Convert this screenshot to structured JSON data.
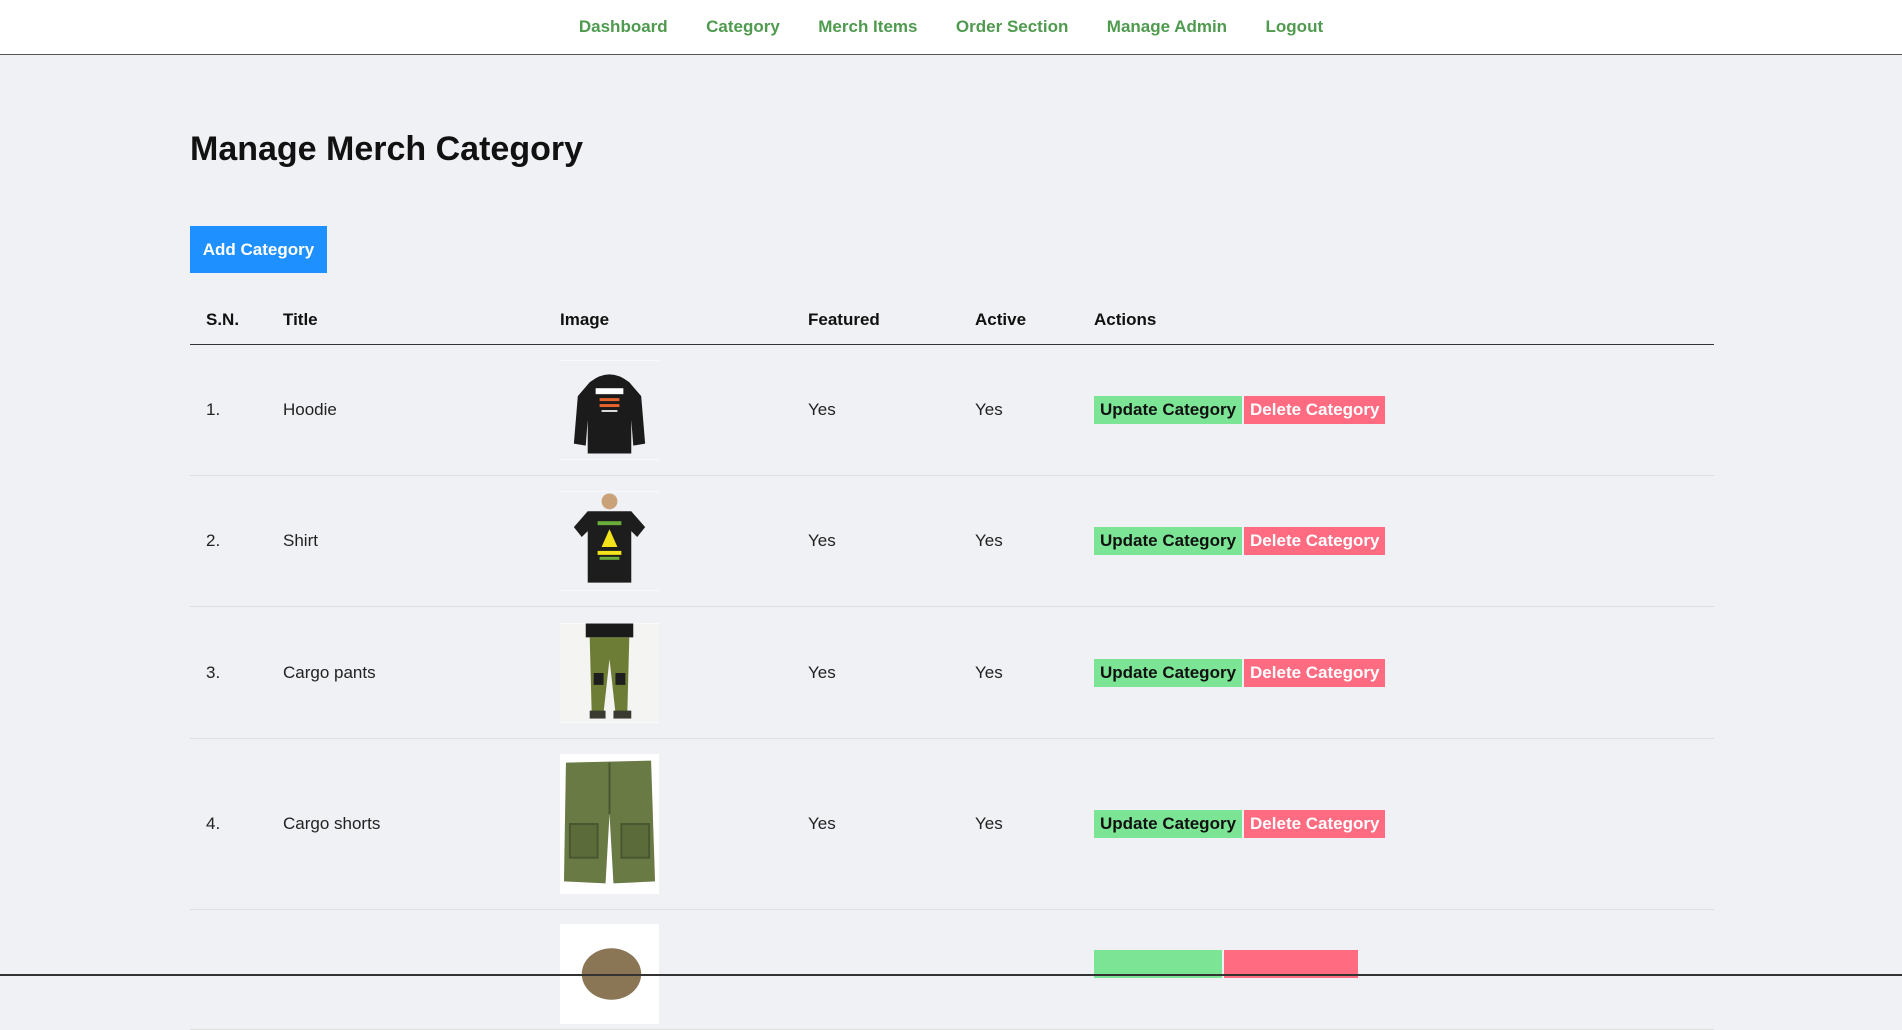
{
  "nav": {
    "items": [
      {
        "label": "Dashboard"
      },
      {
        "label": "Category"
      },
      {
        "label": "Merch Items"
      },
      {
        "label": "Order Section"
      },
      {
        "label": "Manage Admin"
      },
      {
        "label": "Logout"
      }
    ]
  },
  "page": {
    "title": "Manage Merch Category",
    "add_button": "Add Category"
  },
  "table": {
    "headers": [
      "S.N.",
      "Title",
      "Image",
      "Featured",
      "Active",
      "Actions"
    ],
    "rows": [
      {
        "sn": "1.",
        "title": "Hoodie",
        "image": "hoodie-image",
        "featured": "Yes",
        "active": "Yes"
      },
      {
        "sn": "2.",
        "title": "Shirt",
        "image": "shirt-image",
        "featured": "Yes",
        "active": "Yes"
      },
      {
        "sn": "3.",
        "title": "Cargo pants",
        "image": "cargo-pants-image",
        "featured": "Yes",
        "active": "Yes"
      },
      {
        "sn": "4.",
        "title": "Cargo shorts",
        "image": "cargo-shorts-image",
        "featured": "Yes",
        "active": "Yes"
      }
    ],
    "update_label": "Update Category",
    "delete_label": "Delete Category"
  },
  "colors": {
    "nav_link": "#4f9a4f",
    "add_button": "#1e90ff",
    "update_button": "#7be495",
    "delete_button": "#ff6b81"
  }
}
